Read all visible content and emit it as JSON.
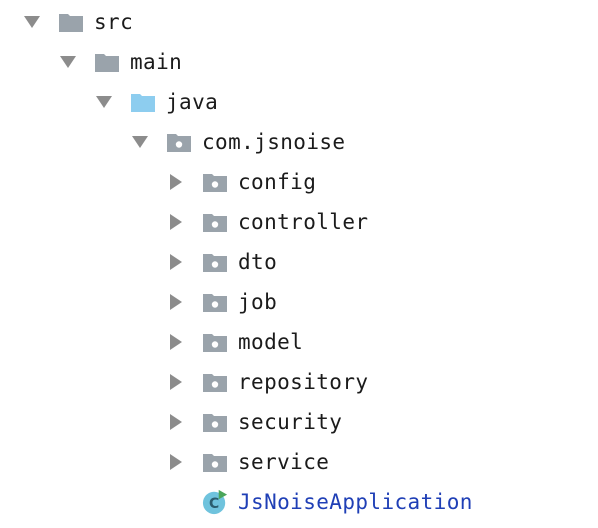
{
  "project_tree": {
    "src": {
      "label": "src",
      "expanded": true
    },
    "main": {
      "label": "main",
      "expanded": true
    },
    "java": {
      "label": "java",
      "expanded": true
    },
    "package": {
      "label": "com.jsnoise",
      "expanded": true
    },
    "folders": [
      {
        "label": "config",
        "icon": "package-folder-icon",
        "expanded": false
      },
      {
        "label": "controller",
        "icon": "package-folder-icon",
        "expanded": false
      },
      {
        "label": "dto",
        "icon": "package-folder-icon",
        "expanded": false
      },
      {
        "label": "job",
        "icon": "package-folder-icon",
        "expanded": false
      },
      {
        "label": "model",
        "icon": "package-folder-icon",
        "expanded": false
      },
      {
        "label": "repository",
        "icon": "package-folder-icon",
        "expanded": false
      },
      {
        "label": "security",
        "icon": "package-folder-icon",
        "expanded": false
      },
      {
        "label": "service",
        "icon": "package-folder-icon",
        "expanded": false
      }
    ],
    "application_class": {
      "label": "JsNoiseApplication",
      "icon": "spring-boot-class-icon",
      "icon_letter": "C"
    }
  },
  "colors": {
    "folder_gray": "#9aa3ab",
    "source_folder_blue": "#8dcdef",
    "arrow_gray": "#8c8c8c",
    "class_link_blue": "#1f3fb6",
    "class_icon_bg": "#6fc3dd",
    "run_marker_green": "#4aa55a"
  }
}
